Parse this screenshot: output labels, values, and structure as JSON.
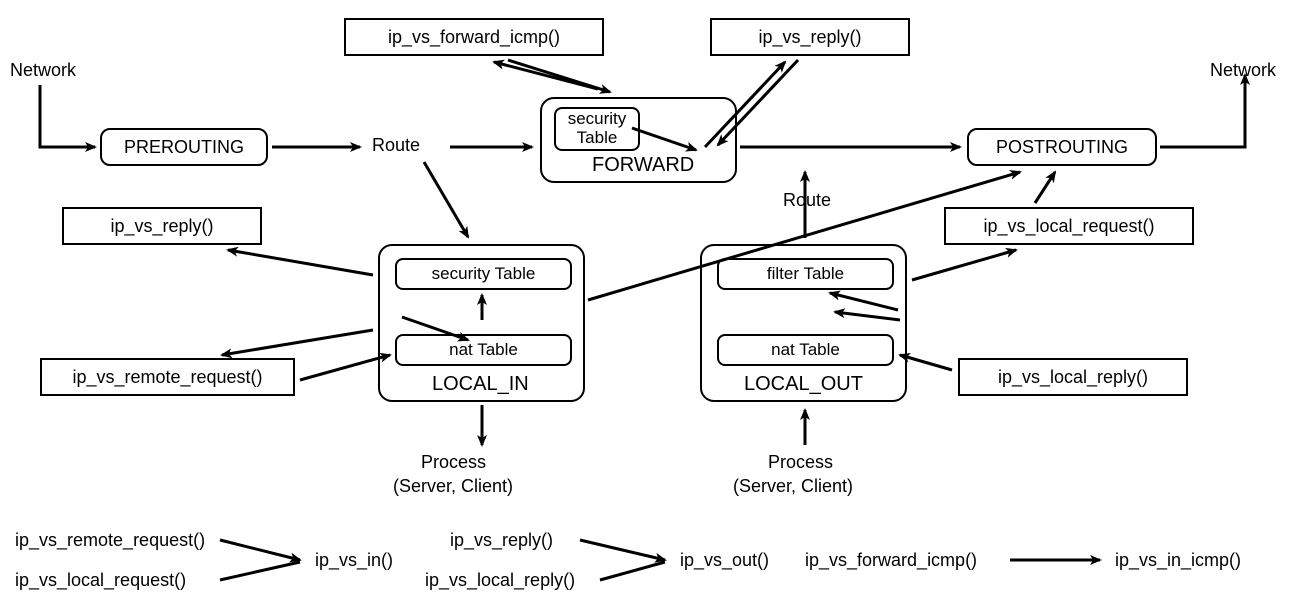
{
  "nodes": {
    "network_in": "Network",
    "network_out": "Network",
    "prerouting": "PREROUTING",
    "route_top": "Route",
    "route_mid": "Route",
    "postrouting": "POSTROUTING",
    "forward": "FORWARD",
    "local_in": "LOCAL_IN",
    "local_out": "LOCAL_OUT",
    "security_table": "security Table",
    "security_table2": "security\nTable",
    "nat_table": "nat Table",
    "nat_table2": "nat Table",
    "filter_table": "filter Table",
    "process_in": "Process",
    "process_in2": "(Server, Client)",
    "process_out": "Process",
    "process_out2": "(Server, Client)"
  },
  "funcs": {
    "forward_icmp": "ip_vs_forward_icmp()",
    "reply_top": "ip_vs_reply()",
    "reply_left": "ip_vs_reply()",
    "local_request": "ip_vs_local_request()",
    "remote_request": "ip_vs_remote_request()",
    "local_reply": "ip_vs_local_reply()"
  },
  "legend": {
    "remote_request": "ip_vs_remote_request()",
    "local_request": "ip_vs_local_request()",
    "in": "ip_vs_in()",
    "reply": "ip_vs_reply()",
    "local_reply": "ip_vs_local_reply()",
    "out": "ip_vs_out()",
    "forward_icmp": "ip_vs_forward_icmp()",
    "in_icmp": "ip_vs_in_icmp()"
  }
}
